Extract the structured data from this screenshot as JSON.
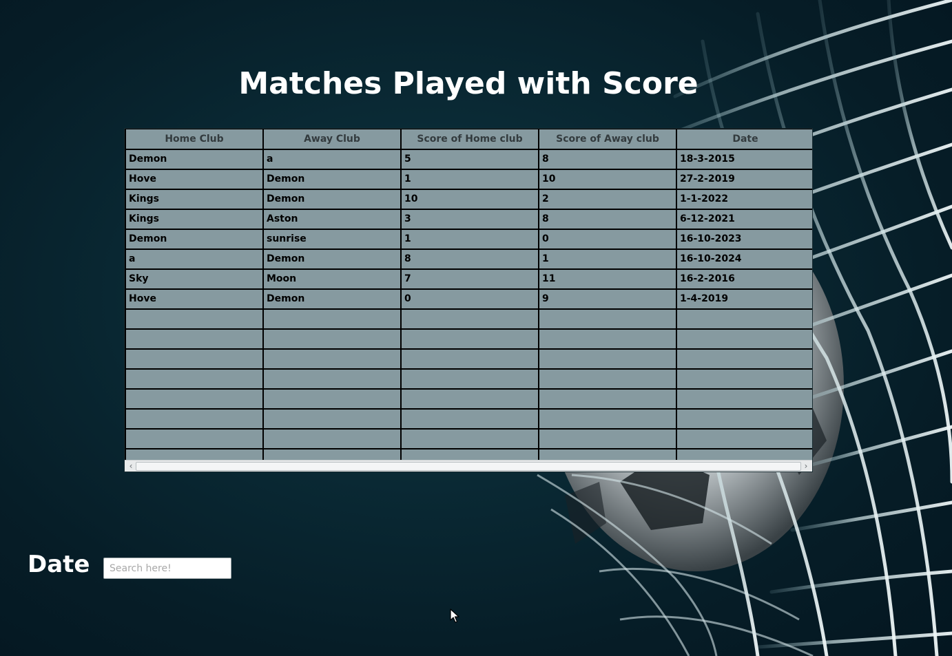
{
  "page": {
    "title": "Matches Played with Score"
  },
  "table": {
    "headers": [
      "Home Club",
      "Away Club",
      "Score of Home club",
      "Score of Away club",
      "Date"
    ],
    "rows": [
      [
        "Demon",
        "a",
        "5",
        "8",
        "18-3-2015"
      ],
      [
        "Hove",
        "Demon",
        "1",
        "10",
        "27-2-2019"
      ],
      [
        "Kings",
        "Demon",
        "10",
        "2",
        "1-1-2022"
      ],
      [
        "Kings",
        "Aston",
        "3",
        "8",
        "6-12-2021"
      ],
      [
        "Demon",
        "sunrise",
        "1",
        "0",
        "16-10-2023"
      ],
      [
        "a",
        "Demon",
        "8",
        "1",
        "16-10-2024"
      ],
      [
        "Sky",
        "Moon",
        "7",
        "11",
        "16-2-2016"
      ],
      [
        "Hove",
        "Demon",
        "0",
        "9",
        "1-4-2019"
      ],
      [
        "",
        "",
        "",
        "",
        ""
      ],
      [
        "",
        "",
        "",
        "",
        ""
      ],
      [
        "",
        "",
        "",
        "",
        ""
      ],
      [
        "",
        "",
        "",
        "",
        ""
      ],
      [
        "",
        "",
        "",
        "",
        ""
      ],
      [
        "",
        "",
        "",
        "",
        ""
      ],
      [
        "",
        "",
        "",
        "",
        ""
      ],
      [
        "",
        "",
        "",
        "",
        ""
      ]
    ]
  },
  "search": {
    "label": "Date",
    "placeholder": "Search here!",
    "value": ""
  },
  "icons": {
    "scroll_left": "chevron-left-icon",
    "scroll_right": "chevron-right-icon",
    "cursor": "mouse-pointer-icon"
  },
  "colors": {
    "background": "#061d27",
    "table_cell": "#869aa0",
    "title_text": "#ffffff"
  }
}
